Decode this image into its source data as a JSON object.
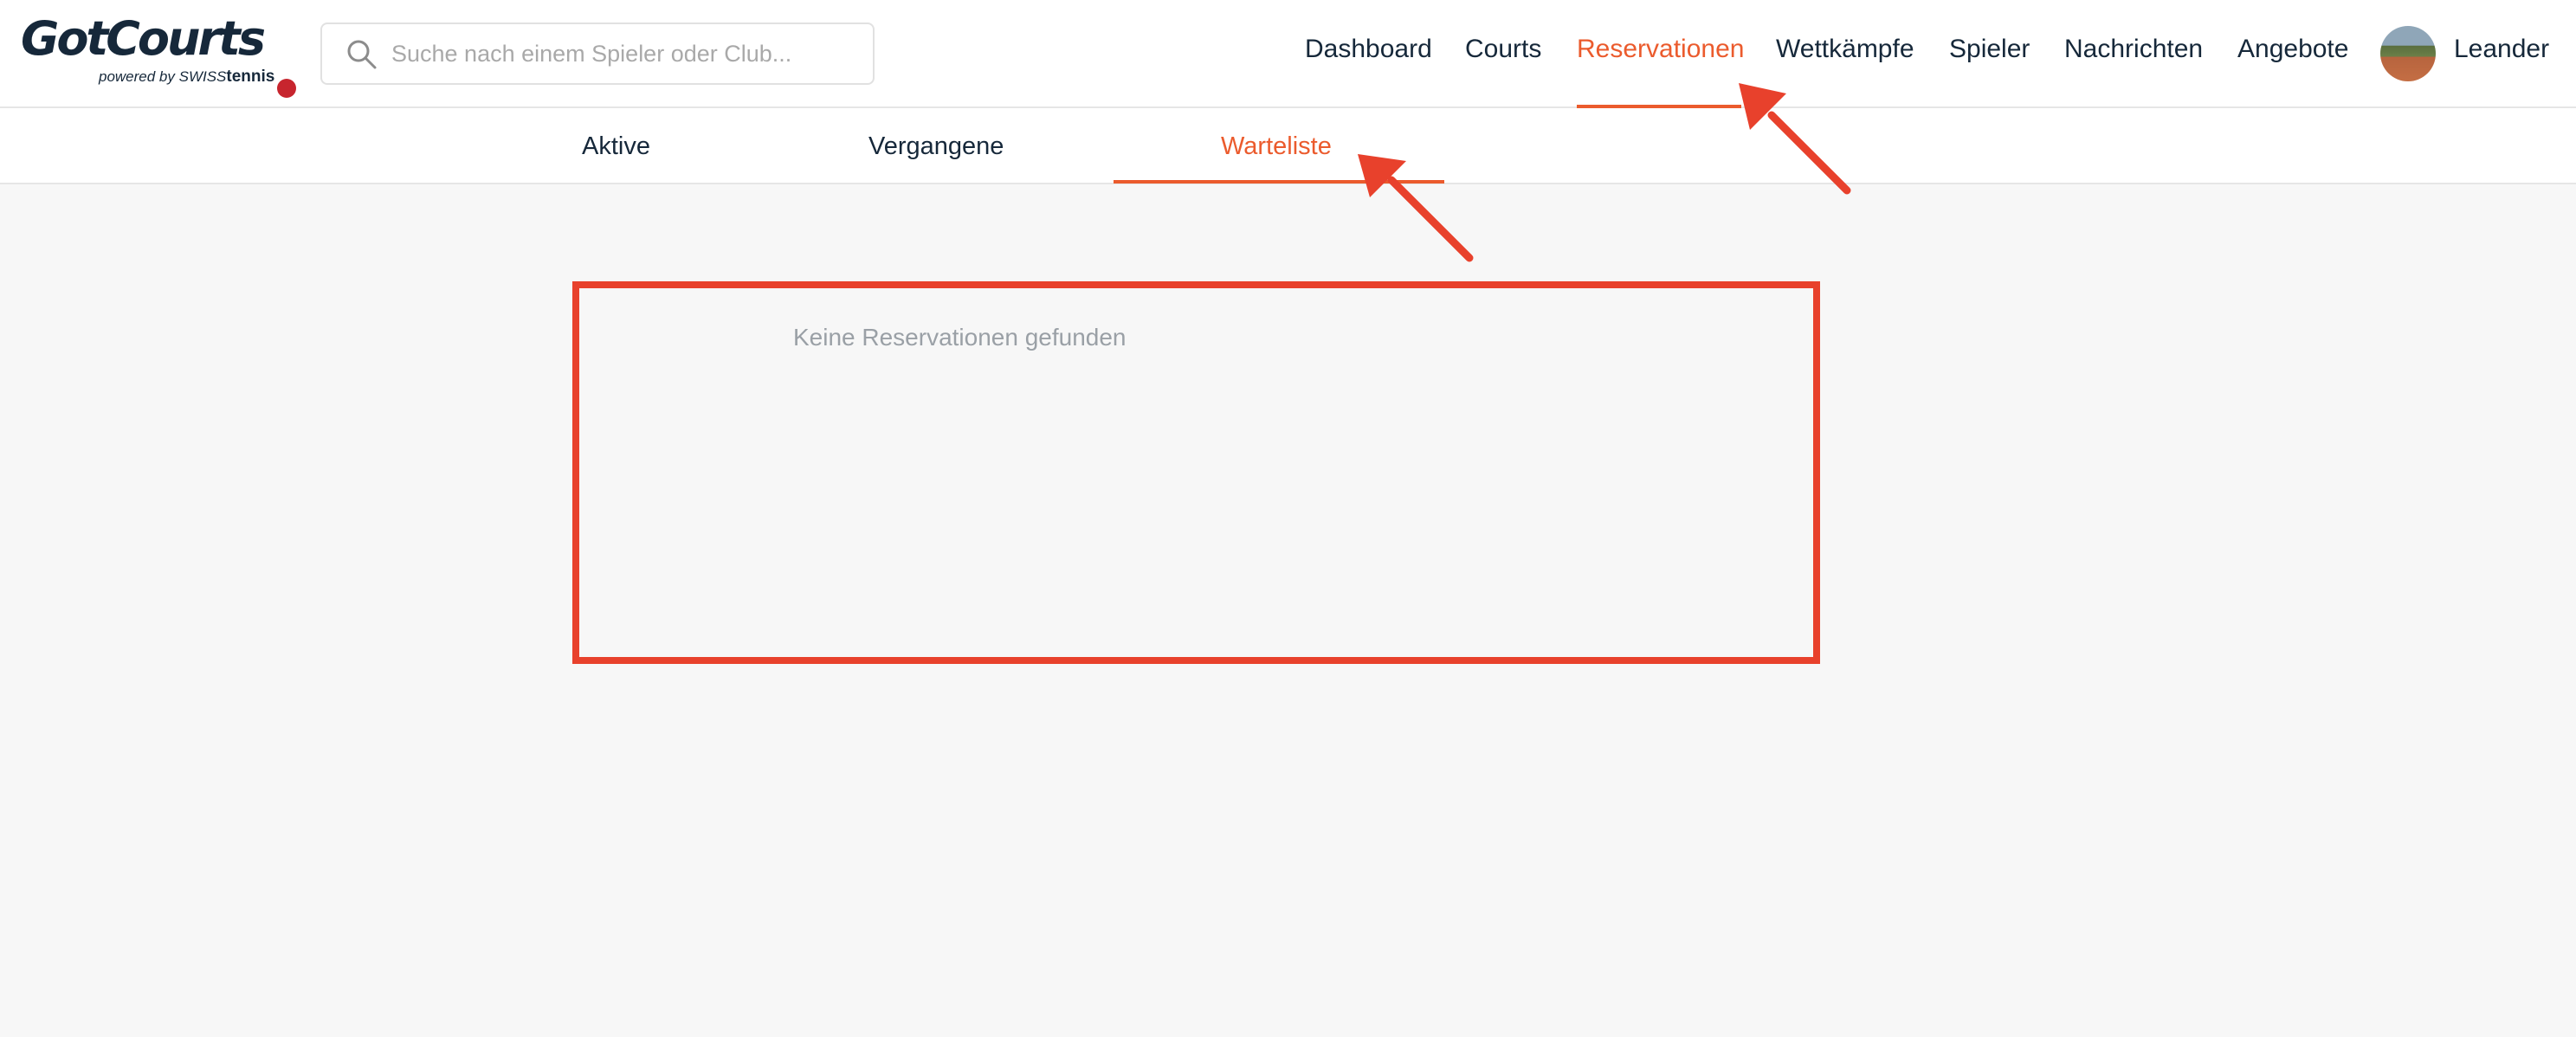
{
  "app": {
    "logo_text": "GotCourts",
    "logo_sub_prefix": "powered by SWISS",
    "logo_sub_brand": "tennis"
  },
  "search": {
    "placeholder": "Suche nach einem Spieler oder Club..."
  },
  "nav": {
    "items": [
      {
        "label": "Dashboard",
        "active": false
      },
      {
        "label": "Courts",
        "active": false
      },
      {
        "label": "Reservationen",
        "active": true
      },
      {
        "label": "Wettkämpfe",
        "active": false
      },
      {
        "label": "Spieler",
        "active": false
      },
      {
        "label": "Nachrichten",
        "active": false
      },
      {
        "label": "Angebote",
        "active": false
      }
    ],
    "user_name": "Leander"
  },
  "subtabs": {
    "items": [
      {
        "label": "Aktive",
        "active": false
      },
      {
        "label": "Vergangene",
        "active": false
      },
      {
        "label": "Warteliste",
        "active": true
      }
    ]
  },
  "main": {
    "empty_message": "Keine Reservationen gefunden"
  },
  "colors": {
    "accent": "#eb5b2d",
    "annotation": "#e8412c",
    "text_dark": "#16283a",
    "background": "#f7f7f7"
  },
  "icons": {
    "search": "search-icon",
    "avatar": "avatar-image"
  }
}
